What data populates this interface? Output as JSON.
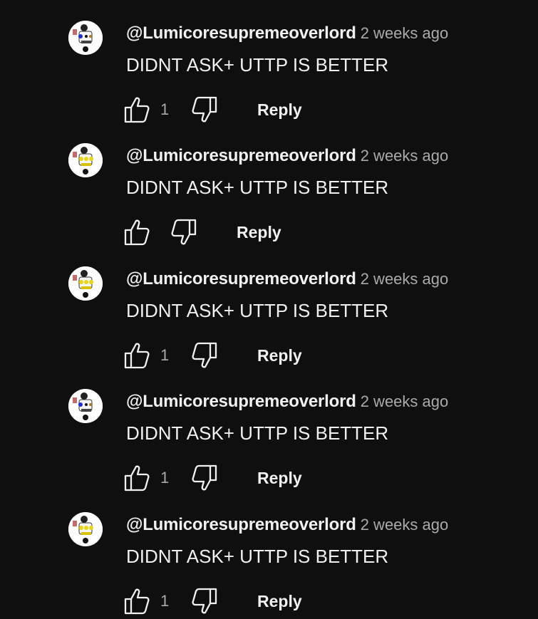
{
  "comments": [
    {
      "author": "@Lumicoresupremeoverlord",
      "time": "2 weeks ago",
      "text": "DIDNT ASK+ UTTP IS BETTER",
      "likes": "1",
      "reply_label": "Reply",
      "avatar_variant": "blue"
    },
    {
      "author": "@Lumicoresupremeoverlord",
      "time": "2 weeks ago",
      "text": "DIDNT ASK+ UTTP IS BETTER",
      "likes": "",
      "reply_label": "Reply",
      "avatar_variant": "yellow"
    },
    {
      "author": "@Lumicoresupremeoverlord",
      "time": "2 weeks ago",
      "text": "DIDNT ASK+ UTTP IS BETTER",
      "likes": "1",
      "reply_label": "Reply",
      "avatar_variant": "yellow"
    },
    {
      "author": "@Lumicoresupremeoverlord",
      "time": "2 weeks ago",
      "text": "DIDNT ASK+ UTTP IS BETTER",
      "likes": "1",
      "reply_label": "Reply",
      "avatar_variant": "blue"
    },
    {
      "author": "@Lumicoresupremeoverlord",
      "time": "2 weeks ago",
      "text": "DIDNT ASK+ UTTP IS BETTER",
      "likes": "1",
      "reply_label": "Reply",
      "avatar_variant": "yellow"
    }
  ],
  "icons": {
    "like": "thumbs-up-icon",
    "dislike": "thumbs-down-icon"
  },
  "colors": {
    "background": "#0f0f0f",
    "primary_text": "#f1f1f1",
    "secondary_text": "#aaaaaa"
  }
}
